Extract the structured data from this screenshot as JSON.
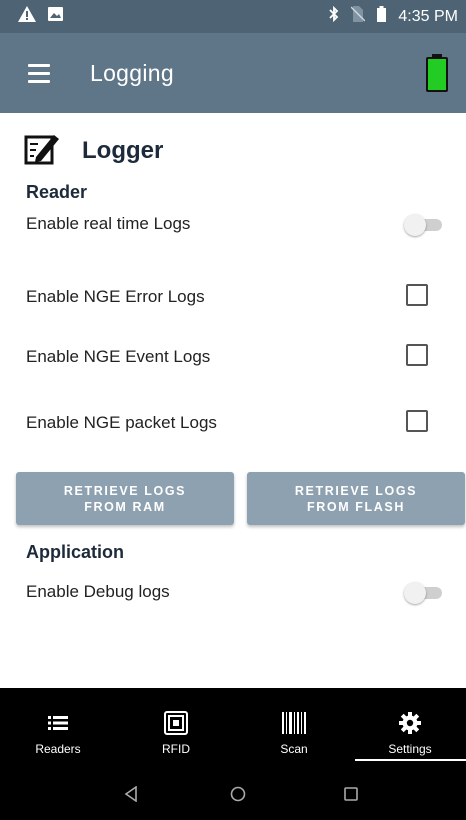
{
  "status_bar": {
    "left_icons": [
      "warning-icon",
      "image-icon"
    ],
    "right_icons": [
      "bluetooth-icon",
      "no-sim-icon",
      "battery-icon"
    ],
    "time": "4:35 PM"
  },
  "app_bar": {
    "title": "Logging",
    "battery_color": "#22cc22"
  },
  "logger": {
    "title": "Logger",
    "reader_section": "Reader",
    "rows": [
      {
        "label": "Enable real time Logs",
        "control": "toggle",
        "checked": false
      },
      {
        "label": "Enable NGE Error Logs",
        "control": "checkbox",
        "checked": false
      },
      {
        "label": "Enable NGE Event Logs",
        "control": "checkbox",
        "checked": false
      },
      {
        "label": "Enable NGE packet Logs",
        "control": "checkbox",
        "checked": false
      }
    ],
    "buttons": {
      "ram_line1": "RETRIEVE LOGS",
      "ram_line2": "FROM RAM",
      "flash_line1": "RETRIEVE LOGS",
      "flash_line2": "FROM FLASH"
    },
    "application_section": "Application",
    "debug_label": "Enable Debug logs",
    "debug_checked": false
  },
  "bottom_nav": {
    "items": [
      {
        "label": "Readers",
        "icon": "list-icon"
      },
      {
        "label": "RFID",
        "icon": "rfid-icon"
      },
      {
        "label": "Scan",
        "icon": "barcode-icon"
      },
      {
        "label": "Settings",
        "icon": "gear-icon"
      }
    ],
    "selected": "Settings"
  },
  "colors": {
    "status_bar": "#4e6374",
    "app_bar": "#5f7689",
    "button": "#8ea1b0",
    "nav": "#000000"
  }
}
